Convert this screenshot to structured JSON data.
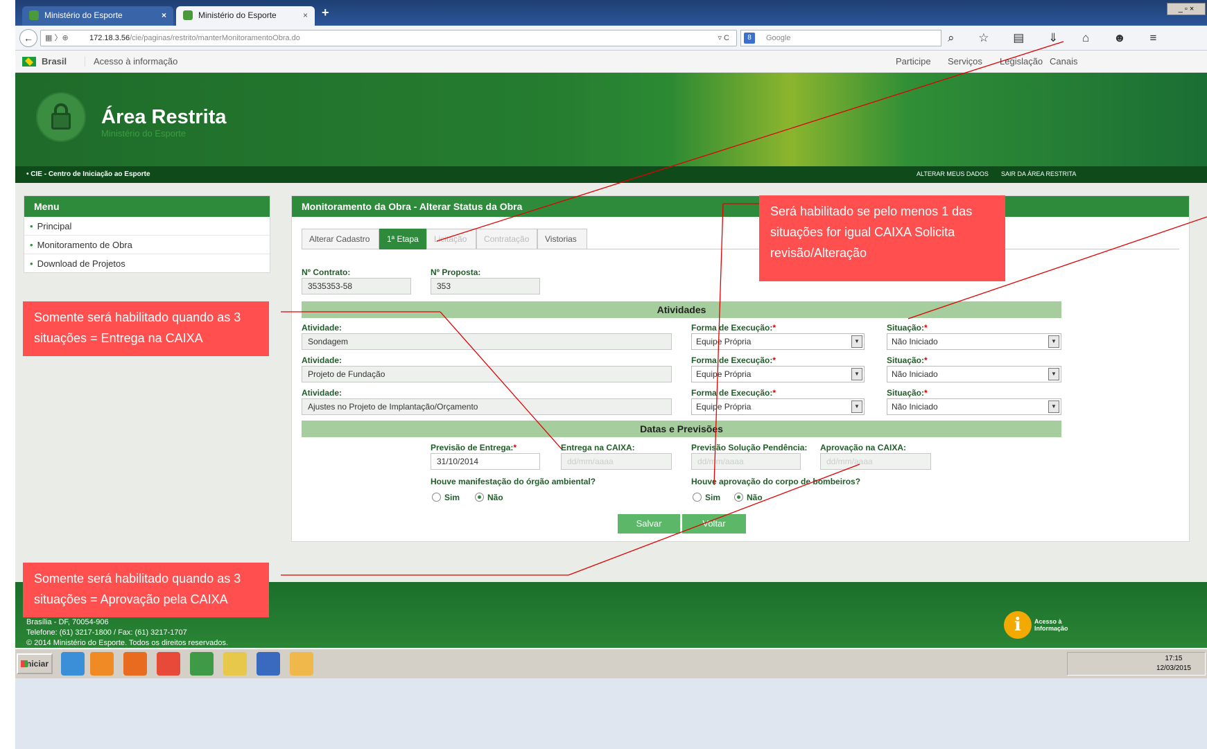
{
  "browser": {
    "tabs": [
      {
        "label": "Ministério do Esporte"
      },
      {
        "label": "Ministério do Esporte"
      }
    ],
    "new_tab": "+",
    "window_controls": "_ ▫ ×",
    "back": "←",
    "url_prefix": "172.18.3.56",
    "url_path": "/cie/paginas/restrito/manterMonitoramentoObra.do",
    "search_placeholder": "Google",
    "toolbar_icons": "⌕ ☆ ▤ ⇓ ⌂ ☻ ≡"
  },
  "gov_bar": {
    "brasil": "Brasil",
    "acesso": "Acesso à informação",
    "links": [
      "Participe",
      "Serviços",
      "Legislação",
      "Canais"
    ]
  },
  "header": {
    "title": "Área Restrita",
    "subtitle": "Ministério do Esporte"
  },
  "sub_bar": {
    "system": "• CIE - Centro de Iniciação ao Esporte",
    "alterar": "ALTERAR MEUS DADOS",
    "sair": "SAIR DA ÁREA RESTRITA"
  },
  "menu": {
    "title": "Menu",
    "items": [
      "Principal",
      "Monitoramento de Obra",
      "Download de Projetos"
    ]
  },
  "panel": {
    "title": "Monitoramento da Obra - Alterar Status da Obra",
    "tabs": [
      {
        "label": "Alterar Cadastro",
        "state": "normal"
      },
      {
        "label": "1ª Etapa",
        "state": "active"
      },
      {
        "label": "Licitação",
        "state": "disabled"
      },
      {
        "label": "Contratação",
        "state": "disabled"
      },
      {
        "label": "Vistorias",
        "state": "normal"
      }
    ],
    "contrato_label": "Nº Contrato:",
    "contrato_value": "3535353-58",
    "proposta_label": "Nº Proposta:",
    "proposta_value": "353",
    "atividades_title": "Atividades",
    "atividade_label": "Atividade:",
    "forma_label": "Forma de Execução:",
    "situacao_label": "Situação:",
    "required_mark": "*",
    "atividades": [
      {
        "atividade": "Sondagem",
        "forma": "Equipe Própria",
        "situacao": "Não Iniciado"
      },
      {
        "atividade": "Projeto de Fundação",
        "forma": "Equipe Própria",
        "situacao": "Não Iniciado"
      },
      {
        "atividade": "Ajustes no Projeto de Implantação/Orçamento",
        "forma": "Equipe Própria",
        "situacao": "Não Iniciado"
      }
    ],
    "datas_title": "Datas e Previsões",
    "previsao_entrega_label": "Previsão de Entrega:",
    "previsao_entrega_value": "31/10/2014",
    "entrega_caixa_label": "Entrega na CAIXA:",
    "previsao_solucao_label": "Previsão Solução Pendência:",
    "aprovacao_caixa_label": "Aprovação na CAIXA:",
    "date_placeholder": "dd/mm/aaaa",
    "orgao_ambiental_label": "Houve manifestação do órgão ambiental?",
    "bombeiros_label": "Houve aprovação do corpo de bombeiros?",
    "sim": "Sim",
    "nao": "Não",
    "salvar": "Salvar",
    "voltar": "Voltar"
  },
  "footer": {
    "address": "Brasília - DF, 70054-906",
    "phone": "Telefone: (61) 3217-1800 / Fax: (61) 3217-1707",
    "copyright": "© 2014 Ministério do Esporte. Todos os direitos reservados.",
    "acesso_logo": "i",
    "acesso_logo_text": "Acesso à Informação"
  },
  "taskbar": {
    "start": "Iniciar",
    "time": "17:15",
    "date": "12/03/2015"
  },
  "annotations": {
    "note_habilitado": "Será habilitado se pelo menos 1 das situações for igual CAIXA Solicita revisão/Alteração",
    "note_entrega": "Somente será habilitado quando as 3 situações = Entrega na CAIXA",
    "note_aprovacao": "Somente será habilitado quando as 3 situações = Aprovação pela CAIXA",
    "color": "#ff4f4f",
    "line_color": "#e00000"
  },
  "colors": {
    "brand_green": "#2e8b3c",
    "section_green": "#a6cd9e",
    "button_green": "#5cb868"
  }
}
